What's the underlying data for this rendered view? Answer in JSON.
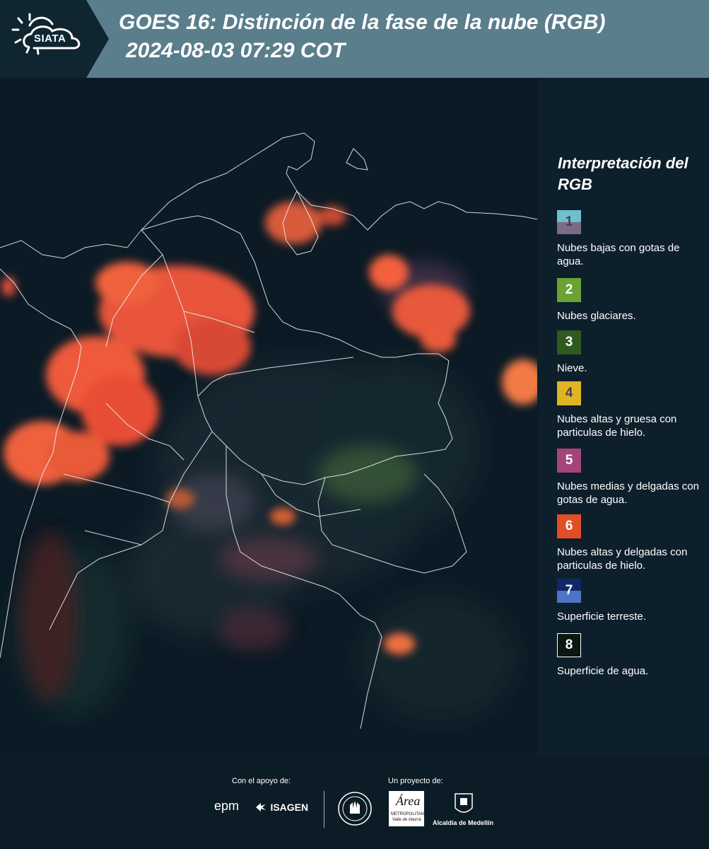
{
  "header": {
    "logo_text": "SIATA",
    "title": "GOES 16: Distinción de la fase de la nube (RGB)",
    "datetime": "2024-08-03 07:29 COT"
  },
  "legend": {
    "title": "Interpretación del RGB",
    "items": [
      {
        "number": "1",
        "label": "Nubes bajas con gotas de agua.",
        "color_top": "#6fbfcc",
        "color_bottom": "#7a6c86"
      },
      {
        "number": "2",
        "label": "Nubes glaciares.",
        "color_top": "#6aa234",
        "color_bottom": "#6aa234"
      },
      {
        "number": "3",
        "label": "Nieve.",
        "color_top": "#2f5a20",
        "color_bottom": "#2f5a20"
      },
      {
        "number": "4",
        "label": "Nubes altas y gruesa con particulas de hielo.",
        "color_top": "#e0b423",
        "color_bottom": "#e0b423"
      },
      {
        "number": "5",
        "label": "Nubes medias y delgadas con gotas de agua.",
        "color_top": "#a3457a",
        "color_bottom": "#a3457a"
      },
      {
        "number": "6",
        "label": "Nubes altas y delgadas con particulas de hielo.",
        "color_top": "#e24f27",
        "color_bottom": "#e24f27"
      },
      {
        "number": "7",
        "label": "Superficie terreste.",
        "color_top": "#12266a",
        "color_bottom": "#4d74c6"
      },
      {
        "number": "8",
        "label": "Superficie de agua.",
        "color_top": "#0b1710",
        "color_bottom": "#0b1710"
      }
    ]
  },
  "footer": {
    "support_label": "Con el apoyo de:",
    "project_label": "Un proyecto de:",
    "logos": {
      "epm": "epm",
      "isagen": "ISAGEN",
      "area": "Área",
      "area_sub1": "METROPOLITANA",
      "area_sub2": "Valle de Aburrá",
      "alcaldia": "Alcaldía de Medellín"
    }
  }
}
